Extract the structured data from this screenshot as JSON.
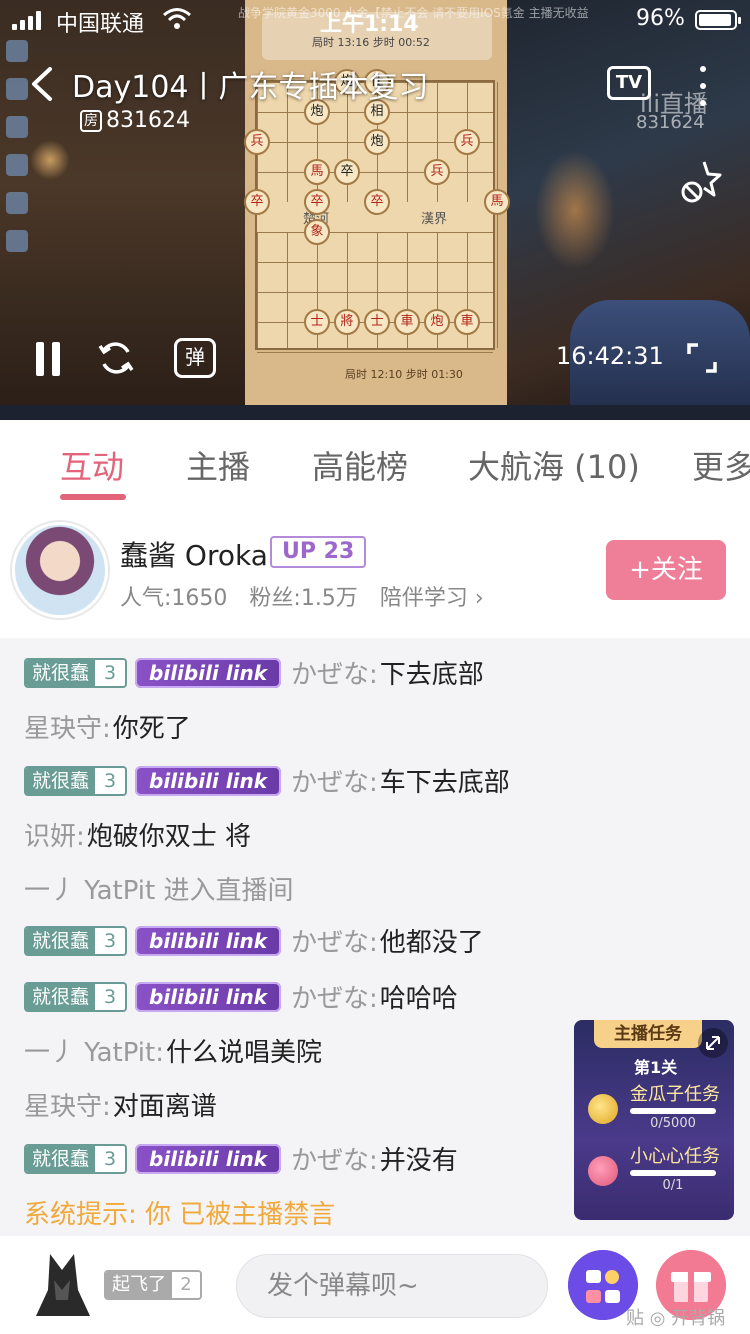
{
  "status_bar": {
    "carrier": "中国联通",
    "time": "上午1:14",
    "battery": "96%",
    "marquee": "战争学院黄金3000 小金【禁止不会  请不要用IOS氪金 主播无收益"
  },
  "player": {
    "title": "Day104丨广东专插本复习",
    "room_id": "831624",
    "room_prefix": "房",
    "tv_label": "TV",
    "watermark_logo": "ili直播",
    "watermark_room": "831624",
    "danmaku_toggle": "弹",
    "clock": "16:42:31",
    "board": {
      "top_info": "局时 13:16  步时 00:52",
      "bottom_info": "局时 12:10  步时 01:30",
      "river_left": "楚河",
      "river_right": "漢界",
      "pieces": [
        "炮",
        "仕",
        "相",
        "炮",
        "炮",
        "兵",
        "兵",
        "馬",
        "卒",
        "卒",
        "卒",
        "卒",
        "馬",
        "象",
        "士",
        "將",
        "士",
        "車",
        "炮",
        "車",
        "兵"
      ]
    }
  },
  "tabs": [
    {
      "label": "互动",
      "active": true
    },
    {
      "label": "主播",
      "active": false
    },
    {
      "label": "高能榜",
      "active": false
    },
    {
      "label": "大航海 (10)",
      "active": false
    },
    {
      "label": "更多",
      "active": false
    }
  ],
  "streamer": {
    "name": "蠢酱 Oroka",
    "up_badge": "UP 23",
    "popularity": "人气:1650",
    "fans": "粉丝:1.5万",
    "category": "陪伴学习",
    "follow_label": "+关注"
  },
  "chat": [
    {
      "medal": "就很蠢",
      "level": "3",
      "link": "bilibili link",
      "user": "かぜな:",
      "text": "下去底部"
    },
    {
      "user": "星玦守:",
      "text": "你死了"
    },
    {
      "medal": "就很蠢",
      "level": "3",
      "link": "bilibili link",
      "user": "かぜな:",
      "text": "车下去底部"
    },
    {
      "user": "识妍:",
      "text": "炮破你双士 将"
    },
    {
      "user": "一丿 YatPit 进入直播间",
      "text": ""
    },
    {
      "medal": "就很蠢",
      "level": "3",
      "link": "bilibili link",
      "user": "かぜな:",
      "text": "他都没了"
    },
    {
      "medal": "就很蠢",
      "level": "3",
      "link": "bilibili link",
      "user": "かぜな:",
      "text": "哈哈哈"
    },
    {
      "user": "一丿 YatPit:",
      "text": "什么说唱美院"
    },
    {
      "user": "星玦守:",
      "text": "对面离谱"
    },
    {
      "medal": "就很蠢",
      "level": "3",
      "link": "bilibili link",
      "user": "かぜな:",
      "text": "并没有"
    },
    {
      "system": "系统提示: 你 已被主播禁言"
    }
  ],
  "mission": {
    "header": "主播任务",
    "level": "第1关",
    "task1_title": "金瓜子任务",
    "task1_progress": "0/5000",
    "task1_fraction": 0,
    "task2_title": "小心心任务",
    "task2_progress": "0/1",
    "task2_fraction": 0
  },
  "bottom": {
    "medal_name": "起飞了",
    "medal_level": "2",
    "input_placeholder": "发个弹幕呗~",
    "foot_hint": "贴 ◎ 开背锅"
  },
  "colors": {
    "accent": "#e2637a",
    "follow": "#ef7f98",
    "medal": "#6a9c96",
    "system": "#f0a93a"
  }
}
